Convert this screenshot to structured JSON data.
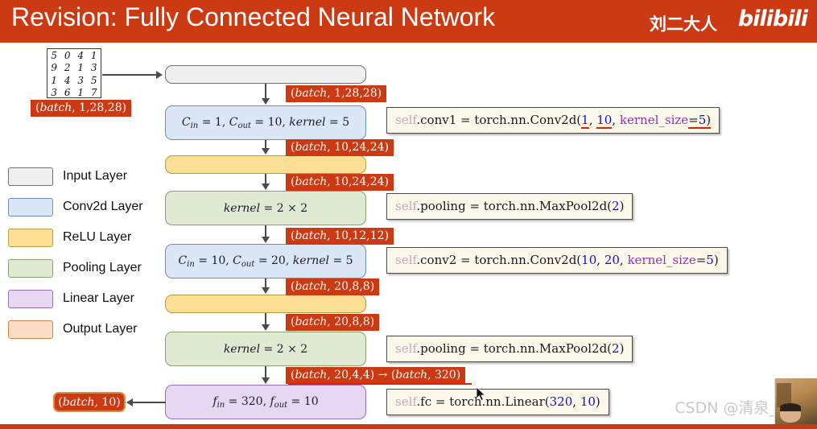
{
  "header": {
    "title": "Revision: Fully Connected Neural Network",
    "author": "刘二大人",
    "logo": "bilibili"
  },
  "legend": {
    "items": [
      {
        "label": "Input Layer",
        "color": "#f0f0f0",
        "border": "#6f6f6f"
      },
      {
        "label": "Conv2d Layer",
        "color": "#dbe7f6",
        "border": "#6f8fb5"
      },
      {
        "label": "ReLU Layer",
        "color": "#fbdf94",
        "border": "#b59a4a"
      },
      {
        "label": "Pooling Layer",
        "color": "#e0ead3",
        "border": "#88a06c"
      },
      {
        "label": "Linear Layer",
        "color": "#e6d7f2",
        "border": "#9b6fc0"
      },
      {
        "label": "Output Layer",
        "color": "#fbddc5",
        "border": "#d08a50"
      }
    ]
  },
  "mnist_sample": {
    "rows": [
      [
        "5",
        "0",
        "4",
        "1"
      ],
      [
        "9",
        "2",
        "1",
        "3"
      ],
      [
        "1",
        "4",
        "3",
        "5"
      ],
      [
        "3",
        "6",
        "1",
        "7"
      ]
    ]
  },
  "nodes": {
    "input": {
      "label": ""
    },
    "conv1": {
      "cin_label": "C",
      "cin_sub": "in",
      "cin_value": "1",
      "cout_label": "C",
      "cout_sub": "out",
      "cout_value": "10",
      "kernel_label": "kernel",
      "kernel_value": "5"
    },
    "relu1": {
      "label": ""
    },
    "pool1": {
      "kernel_label": "kernel",
      "kernel_value": "2 × 2"
    },
    "conv2": {
      "cin_label": "C",
      "cin_sub": "in",
      "cin_value": "10",
      "cout_label": "C",
      "cout_sub": "out",
      "cout_value": "20",
      "kernel_label": "kernel",
      "kernel_value": "5"
    },
    "relu2": {
      "label": ""
    },
    "pool2": {
      "kernel_label": "kernel",
      "kernel_value": "2 × 2"
    },
    "linear": {
      "fin_label": "f",
      "fin_sub": "in",
      "fin_value": "320",
      "fout_label": "f",
      "fout_sub": "out",
      "fout_value": "10"
    },
    "output": {
      "prefix": "(",
      "italic": "batch",
      "rest": ", 10)"
    }
  },
  "tensor_tags": [
    {
      "italic": "batch",
      "rest": ", 1,28,28)",
      "name": "tag-input-shape"
    },
    {
      "italic": "batch",
      "rest": ", 1,28,28)",
      "name": "tag-after-input"
    },
    {
      "italic": "batch",
      "rest": ", 10,24,24)",
      "name": "tag-after-conv1"
    },
    {
      "italic": "batch",
      "rest": ", 10,24,24)",
      "name": "tag-after-relu1"
    },
    {
      "italic": "batch",
      "rest": ", 10,12,12)",
      "name": "tag-after-pool1"
    },
    {
      "italic": "batch",
      "rest": ", 20,8,8)",
      "name": "tag-after-conv2"
    },
    {
      "italic": "batch",
      "rest": ", 20,8,8)",
      "name": "tag-after-relu2"
    }
  ],
  "flatten_tag": {
    "part1_italic": "batch",
    "part1_rest": ", 20,4,4)",
    "arrow": " → ",
    "part2_prefix": "(",
    "part2_italic": "batch",
    "part2_rest": ", 320)"
  },
  "code_lines": {
    "conv1": {
      "self": "self",
      "attr": ".conv1 = torch.nn.Conv2d(",
      "arg1": "1",
      "sep1": ",  ",
      "arg2": "10",
      "sep2": ",  ",
      "kw": "kernel_size",
      "eq": "=",
      "arg3": "5",
      "close": ")"
    },
    "pool1": {
      "self": "self",
      "attr": ".pooling = torch.nn.MaxPool2d(",
      "arg1": "2",
      "close": ")"
    },
    "conv2": {
      "self": "self",
      "attr": ".conv2 = torch.nn.Conv2d(",
      "arg1": "10",
      "sep1": ",  ",
      "arg2": "20",
      "sep2": ",  ",
      "kw": "kernel_size",
      "eq": "=",
      "arg3": "5",
      "close": ")"
    },
    "pool2": {
      "self": "self",
      "attr": ".pooling = torch.nn.MaxPool2d(",
      "arg1": "2",
      "close": ")"
    },
    "fc": {
      "self": "self",
      "attr": ".fc = torch.nn.Linear(",
      "arg1": "320",
      "sep1": ",  ",
      "arg2": "10",
      "close": ")"
    }
  },
  "watermark": {
    "text": "CSDN @清泉_流响"
  },
  "colors": {
    "brand_red": "#cc3a14",
    "underline_red": "#e02000",
    "code_number": "#1010d0",
    "code_keyword": "#9b30b8"
  }
}
